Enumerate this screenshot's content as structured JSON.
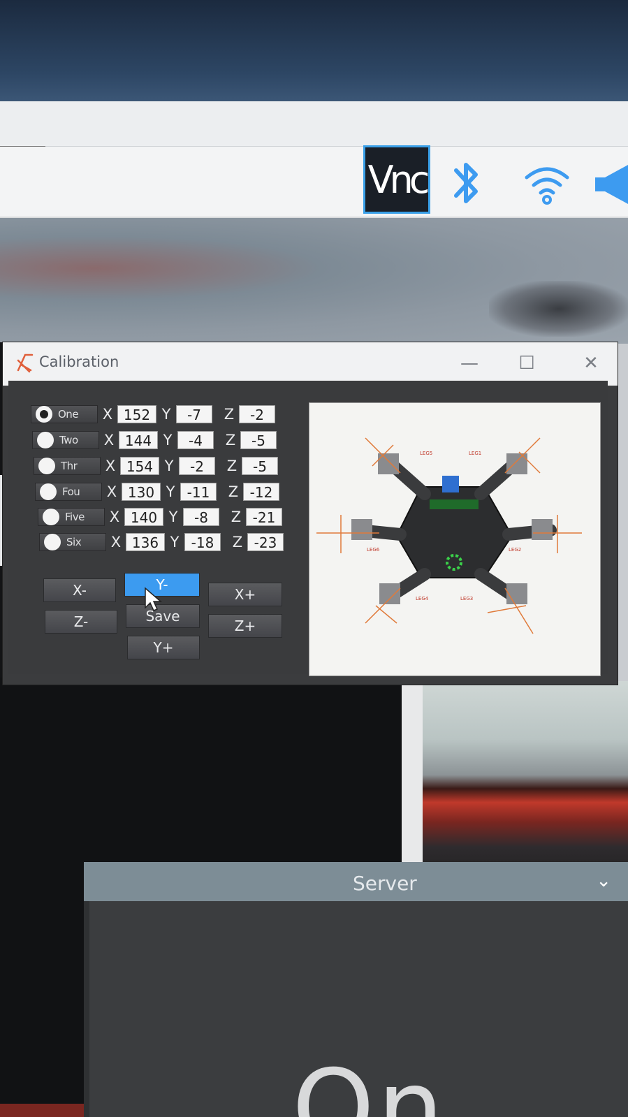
{
  "taskbar": {
    "icons": [
      "vnc-icon",
      "bluetooth-icon",
      "wifi-icon",
      "speaker-icon"
    ],
    "vnc_label": "Vnc"
  },
  "calibration": {
    "title": "Calibration",
    "window_controls": {
      "minimize": "—",
      "maximize": "☐",
      "close": "✕"
    },
    "legs": [
      {
        "label": "One",
        "selected": true,
        "x": "152",
        "y": "-7",
        "z": "-2"
      },
      {
        "label": "Two",
        "selected": false,
        "x": "144",
        "y": "-4",
        "z": "-5"
      },
      {
        "label": "Thr",
        "selected": false,
        "x": "154",
        "y": "-2",
        "z": "-5"
      },
      {
        "label": "Fou",
        "selected": false,
        "x": "130",
        "y": "-11",
        "z": "-12"
      },
      {
        "label": "Five",
        "selected": false,
        "x": "140",
        "y": "-8",
        "z": "-21"
      },
      {
        "label": "Six",
        "selected": false,
        "x": "136",
        "y": "-18",
        "z": "-23"
      }
    ],
    "axis_labels": {
      "x": "X",
      "y": "Y",
      "z": "Z"
    },
    "buttons": {
      "x_minus": "X-",
      "y_minus": "Y-",
      "x_plus": "X+",
      "z_minus": "Z-",
      "save": "Save",
      "z_plus": "Z+",
      "y_plus": "Y+"
    },
    "diagram": {
      "leg_labels": [
        "LEG6",
        "LEG1",
        "LEG5",
        "LEG2",
        "LEG4",
        "LEG3"
      ]
    }
  },
  "server": {
    "title": "Server",
    "state": "On"
  },
  "colors": {
    "active_button": "#3c9bf0",
    "window_bg": "#3b3c3e",
    "accent_vnc": "#3aa0e8"
  }
}
